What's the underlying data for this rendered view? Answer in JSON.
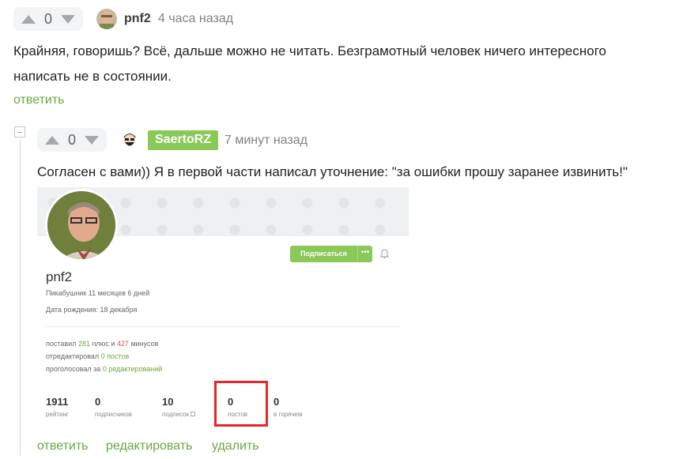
{
  "comment1": {
    "score": "0",
    "author": "pnf2",
    "time": "4 часа назад",
    "text_line1": "Крайняя, говоришь? Всё, дальше можно не читать. Безграмотный человек ничего интересного",
    "text_line2": "написать не в состоянии.",
    "reply": "ответить"
  },
  "comment2": {
    "score": "0",
    "author": "SaertoRZ",
    "time": "7 минут назад",
    "text": "Согласен с вами)) Я в первой части написал уточнение: \"за ошибки прошу заранее извинить!\"",
    "actions": {
      "reply": "ответить",
      "edit": "редактировать",
      "delete": "удалить"
    }
  },
  "profile_shot": {
    "subscribe_label": "Подписаться",
    "more": "•••",
    "name": "pnf2",
    "tenure": "Пикабушник 11 месяцев 6 дней",
    "birthday": "Дата рождения: 18 декабря",
    "voted_prefix": "поставил ",
    "pluses": "281",
    "voted_mid": " плюс и ",
    "minuses": "427",
    "voted_suffix": " минусов",
    "edited_prefix": "отредактировал ",
    "edited_value": "0 постов",
    "voted_edits_prefix": "проголосовал за ",
    "voted_edits_value": "0 редактирований",
    "stats": [
      {
        "value": "1911",
        "label": "рейтинг"
      },
      {
        "value": "0",
        "label": "подписчиков"
      },
      {
        "value": "10",
        "label": "подписок"
      },
      {
        "value": "0",
        "label": "постов"
      },
      {
        "value": "0",
        "label": "в горячем"
      }
    ]
  },
  "colors": {
    "accent_green": "#8ac858",
    "link_green": "#6aa83f",
    "highlight_red": "#e52629"
  }
}
